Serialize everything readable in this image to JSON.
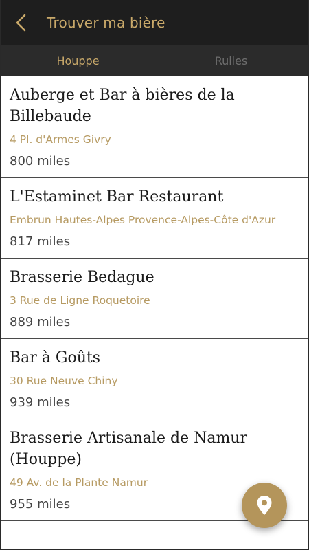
{
  "header": {
    "title": "Trouver ma bière",
    "back_icon": "chevron-left-icon"
  },
  "tabs": [
    {
      "label": "Houppe",
      "active": true
    },
    {
      "label": "Rulles",
      "active": false
    }
  ],
  "results": [
    {
      "name": "Auberge et Bar à bières de la Billebaude",
      "address": "4 Pl. d'Armes Givry",
      "distance": "800 miles"
    },
    {
      "name": "L'Estaminet Bar Restaurant",
      "address": "Embrun Hautes-Alpes Provence-Alpes-Côte d'Azur",
      "distance": "817 miles"
    },
    {
      "name": "Brasserie Bedague",
      "address": "3 Rue de Ligne Roquetoire",
      "distance": "889 miles"
    },
    {
      "name": "Bar à Goûts",
      "address": "30 Rue Neuve Chiny",
      "distance": "939 miles"
    },
    {
      "name": "Brasserie Artisanale de Namur (Houppe)",
      "address": "49 Av. de la Plante Namur",
      "distance": "955 miles"
    }
  ],
  "fab": {
    "icon": "map-pin-icon"
  },
  "colors": {
    "header_bg": "#1e1e1e",
    "tabs_bg": "#2b2b2b",
    "accent_gold": "#c9a96a",
    "address_gold": "#b69a62",
    "fab_bg": "#b4955b"
  }
}
